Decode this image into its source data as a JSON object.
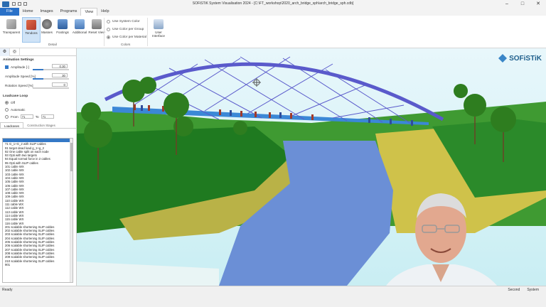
{
  "window": {
    "title": "SOFiSTiK System Visualisation 2024 - [C:\\FT_workshop\\2020_arch_bridge_sph\\arch_bridge_sph.cdb]"
  },
  "ribbon": {
    "tabs": [
      "File",
      "Home",
      "Images",
      "Programs",
      "View",
      "Help"
    ],
    "active_tab": "View",
    "buttons": [
      {
        "key": "transparent",
        "label": "Transparent"
      },
      {
        "key": "tendons",
        "label": "Tendons"
      },
      {
        "key": "masses",
        "label": "Masses"
      },
      {
        "key": "footings",
        "label": "Footings"
      },
      {
        "key": "additional",
        "label": "Additional"
      },
      {
        "key": "reset_view",
        "label": "Reset View"
      }
    ],
    "group_detail": "Detail",
    "color_options": [
      "Use System Color",
      "Use Color per Group",
      "Use Color per Material"
    ],
    "group_colors": "Colors",
    "user_interface_label": "User Interface"
  },
  "panel": {
    "animation_title": "Animation Settings",
    "amplitude_label": "Amplitude [-]",
    "amplitude_value": "0.30",
    "amplitude_speed_label": "Amplitude Speed [%]",
    "amplitude_speed_value": "30",
    "rotation_speed_label": "Rotation Speed [%]",
    "rotation_speed_value": "0",
    "loadcase_loop_title": "Loadcase Loop",
    "loop_options": [
      "Off",
      "Automatic",
      "From"
    ],
    "from_value": "71",
    "to_label": "To",
    "to_value": "71",
    "list_tabs": [
      "Loadcases",
      "Construction Stages"
    ],
    "loadcases": [
      "",
      "71 G_1+G_2 with SLIP cables",
      "91 target dead load g_1+g_2",
      "92 One cable split on each node",
      "93 Opti with two targets",
      "94 Equal normal force in 2 cables",
      "95 Opti with SLIP cables",
      "101 cable WX",
      "102 cable WX",
      "103 cable WX",
      "104 cable WX",
      "105 cable WX",
      "106 cable WX",
      "107 cable WX",
      "108 cable WX",
      "109 cable WX",
      "110 cable WX",
      "111 cable WX",
      "112 cable WX",
      "113 cable WX",
      "114 cable WX",
      "115 cable WX",
      "116 cable WX",
      "201 scalable shortening SLIP cables",
      "202 scalable shortening SLIP cables",
      "203 scalable shortening SLIP cables",
      "204 scalable shortening SLIP cables",
      "205 scalable shortening SLIP cables",
      "206 scalable shortening SLIP cables",
      "207 scalable shortening SLIP cables",
      "208 scalable shortening SLIP cables",
      "209 scalable shortening SLIP cables",
      "210 scalable shortening SLIP cables",
      "901"
    ]
  },
  "viewport": {
    "logo_text": "SOFiSTiK"
  },
  "status": {
    "left": "Ready",
    "right": [
      "Second",
      "System"
    ]
  }
}
